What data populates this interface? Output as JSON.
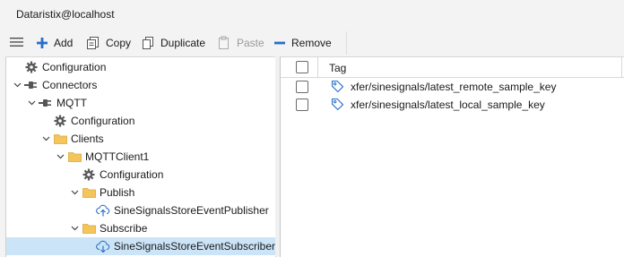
{
  "window": {
    "title": "Dataristix@localhost"
  },
  "toolbar": {
    "add_label": "Add",
    "copy_label": "Copy",
    "duplicate_label": "Duplicate",
    "paste_label": "Paste",
    "remove_label": "Remove"
  },
  "tree": {
    "items": [
      {
        "label": "Configuration",
        "icon": "gear-icon"
      },
      {
        "label": "Connectors",
        "icon": "plug-icon",
        "expanded": true
      },
      {
        "label": "MQTT",
        "icon": "plug-icon",
        "expanded": true
      },
      {
        "label": "Configuration",
        "icon": "gear-icon"
      },
      {
        "label": "Clients",
        "icon": "folder-icon",
        "expanded": true
      },
      {
        "label": "MQTTClient1",
        "icon": "folder-icon",
        "expanded": true
      },
      {
        "label": "Configuration",
        "icon": "gear-icon"
      },
      {
        "label": "Publish",
        "icon": "folder-icon",
        "expanded": true
      },
      {
        "label": "SineSignalsStoreEventPublisher",
        "icon": "cloud-upload-icon"
      },
      {
        "label": "Subscribe",
        "icon": "folder-icon",
        "expanded": true
      },
      {
        "label": "SineSignalsStoreEventSubscriber",
        "icon": "cloud-download-icon",
        "selected": true
      }
    ]
  },
  "grid": {
    "header": {
      "tag_label": "Tag"
    },
    "rows": [
      {
        "tag": "xfer/sinesignals/latest_remote_sample_key",
        "checked": false
      },
      {
        "tag": "xfer/sinesignals/latest_local_sample_key",
        "checked": false
      }
    ]
  },
  "colors": {
    "accent": "#2a6fc9",
    "folder": "#f3c55b",
    "selection": "#cce4f7"
  }
}
